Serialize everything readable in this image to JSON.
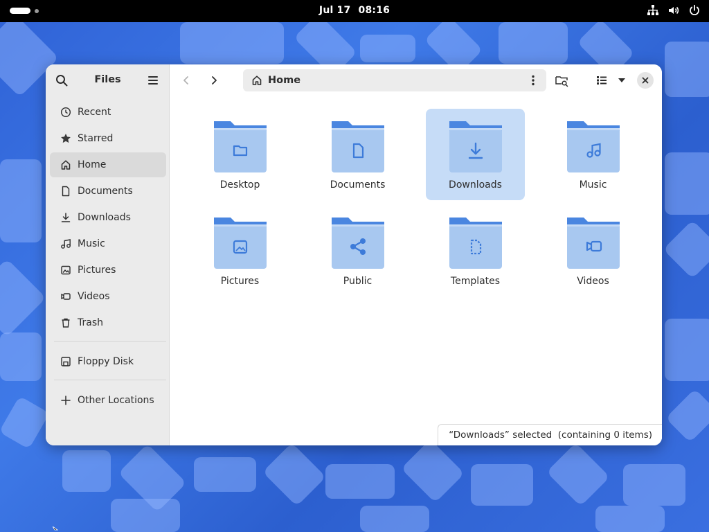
{
  "topbar": {
    "date": "Jul 17",
    "time": "08:16",
    "tray_icons": [
      "network-icon",
      "volume-icon",
      "power-icon"
    ]
  },
  "sidebar": {
    "title": "Files",
    "items": [
      {
        "label": "Recent",
        "icon": "clock-icon"
      },
      {
        "label": "Starred",
        "icon": "star-icon"
      },
      {
        "label": "Home",
        "icon": "home-icon",
        "active": true
      },
      {
        "label": "Documents",
        "icon": "document-icon"
      },
      {
        "label": "Downloads",
        "icon": "download-icon"
      },
      {
        "label": "Music",
        "icon": "music-icon"
      },
      {
        "label": "Pictures",
        "icon": "picture-icon"
      },
      {
        "label": "Videos",
        "icon": "video-icon"
      },
      {
        "label": "Trash",
        "icon": "trash-icon"
      }
    ],
    "devices": [
      {
        "label": "Floppy Disk",
        "icon": "floppy-icon"
      }
    ],
    "other": {
      "label": "Other Locations",
      "icon": "plus-icon"
    }
  },
  "pathbar": {
    "location": "Home"
  },
  "folders": [
    {
      "label": "Desktop",
      "emblem": "folder-emblem"
    },
    {
      "label": "Documents",
      "emblem": "document-emblem"
    },
    {
      "label": "Downloads",
      "emblem": "download-emblem",
      "selected": true
    },
    {
      "label": "Music",
      "emblem": "music-emblem"
    },
    {
      "label": "Pictures",
      "emblem": "picture-emblem"
    },
    {
      "label": "Public",
      "emblem": "share-emblem"
    },
    {
      "label": "Templates",
      "emblem": "template-emblem"
    },
    {
      "label": "Videos",
      "emblem": "video-emblem"
    }
  ],
  "status": {
    "text": "“Downloads” selected  (containing 0 items)"
  },
  "colors": {
    "folder_body": "#a8c8f0",
    "folder_tab": "#4a86e0",
    "emblem": "#3d7bd9",
    "selection": "#c6dcf7",
    "sidebar_bg": "#ebebeb"
  }
}
